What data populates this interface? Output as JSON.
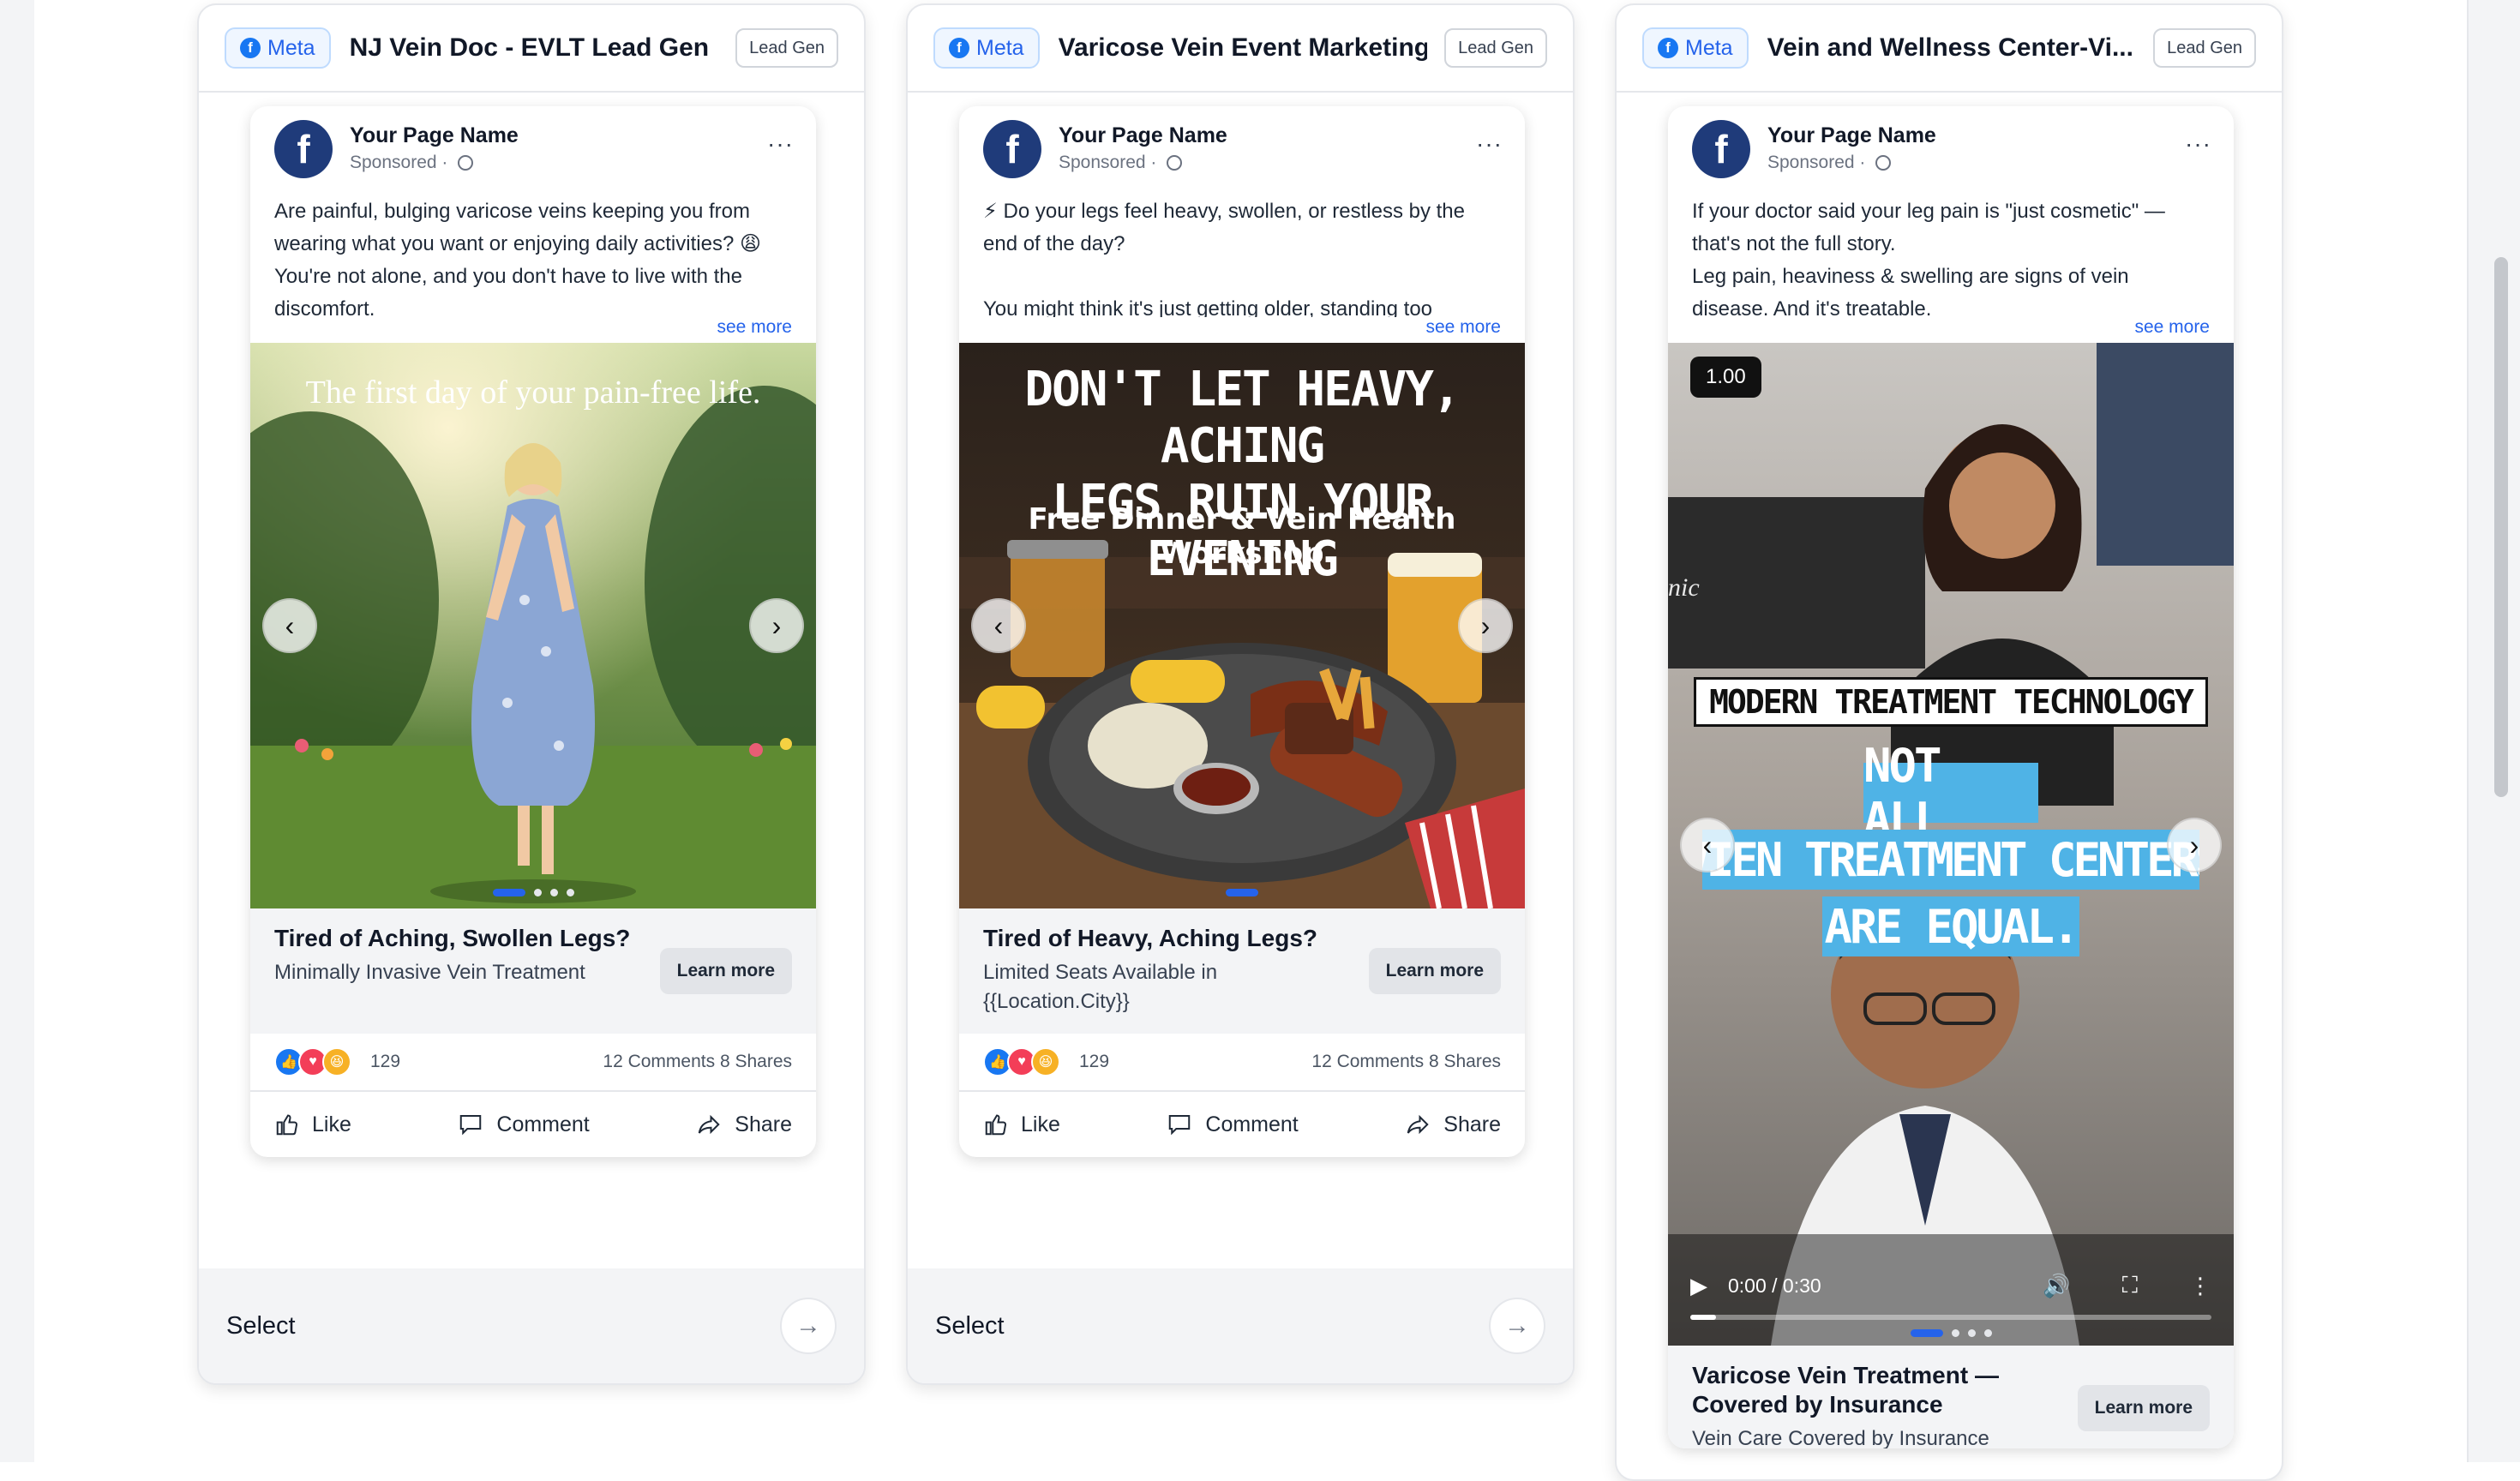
{
  "page_name": "Your Page Name",
  "sponsored": "Sponsored",
  "see_more": "see more",
  "learn_more": "Learn more",
  "like": "Like",
  "comment": "Comment",
  "share": "Share",
  "select": "Select",
  "meta": "Meta",
  "cards": [
    {
      "title": "NJ Vein Doc - EVLT Lead Gen",
      "badge": "Lead Gen",
      "post_text": "Are painful, bulging varicose veins keeping you from wearing what you want or enjoying daily activities? 😩\nYou're not alone, and you don't have to live with the discomfort.",
      "image_text": "The first day of your pain-free life.",
      "headline": "Tired of Aching, Swollen Legs?",
      "description": "Minimally Invasive Vein Treatment",
      "reactions": "129",
      "comments_shares": "12 Comments 8 Shares"
    },
    {
      "title": "Varicose Vein Event Marketing",
      "badge": "Lead Gen",
      "post_text": "⚡ Do your legs feel heavy, swollen, or restless by the end of the day?\n\nYou might think it's just getting older, standing too",
      "image_line1": "DON'T LET HEAVY, ACHING",
      "image_line2": "LEGS RUIN YOUR EVENING",
      "image_line3": "Free Dinner & Vein Health Workshop",
      "headline": "Tired of Heavy, Aching Legs?",
      "description": "Limited Seats Available in {{Location.City}}",
      "reactions": "129",
      "comments_shares": "12 Comments 8 Shares"
    },
    {
      "title": "Vein and Wellness Center-Vi...",
      "badge": "Lead Gen",
      "post_text": "If your doctor said your leg pain is \"just cosmetic\" — that's not the full story.\nLeg pain, heaviness & swelling are signs of vein disease. And it's treatable.",
      "speed": "1.00",
      "video_partial_text": "nic",
      "video_line1": "MODERN TREATMENT TECHNOLOGY",
      "video_line2": "NOT ALL",
      "video_line3": "VIEN TREATMENT CENTERS",
      "video_line4": "ARE EQUAL.",
      "video_time": "0:00 / 0:30",
      "video_progress": 0.05,
      "headline": "Varicose Vein Treatment — Covered by Insurance",
      "description": "Vein Care Covered by Insurance"
    }
  ]
}
